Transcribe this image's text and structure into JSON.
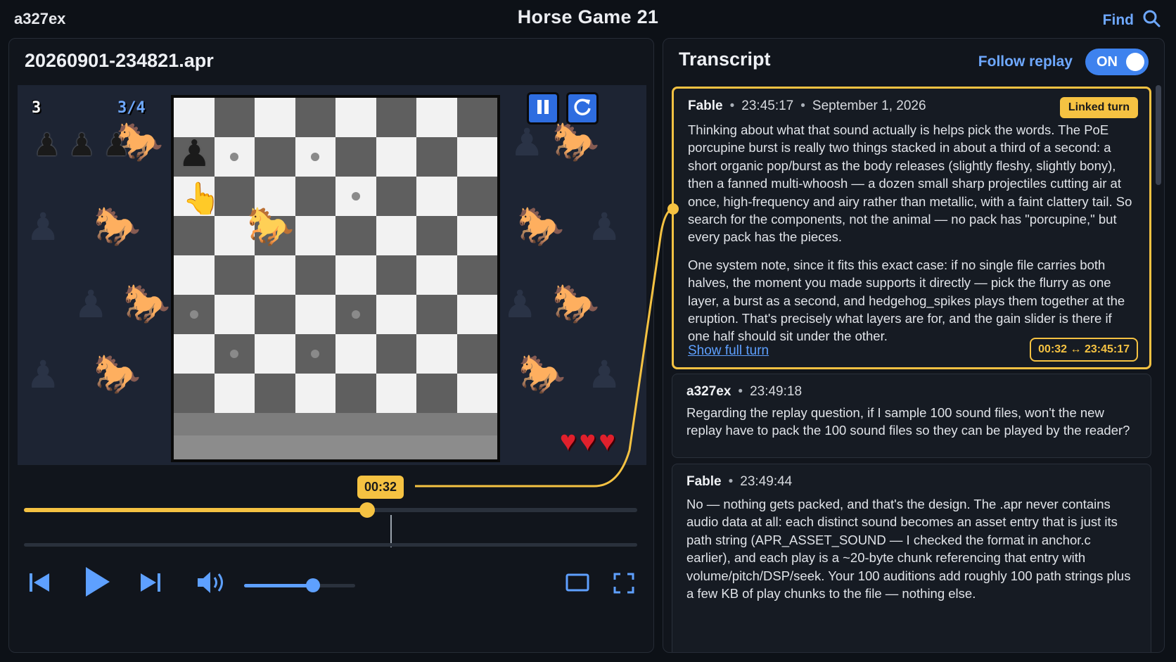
{
  "topbar": {
    "user": "a327ex",
    "title": "Horse Game 21",
    "find_label": "Find"
  },
  "player": {
    "filename": "20260901-234821.apr",
    "hud": {
      "level": "3",
      "pawns_count": "3/4",
      "pawns_remaining": 3,
      "hearts": 3
    },
    "game_controls": {
      "pause_icon": "pause-icon",
      "restart_icon": "restart-icon"
    },
    "timeline": {
      "current_time": "00:32",
      "progress": 0.56
    },
    "volume": {
      "level": 0.62
    },
    "controls": [
      "skip-back-icon",
      "play-icon",
      "skip-forward-icon",
      "volume-icon",
      "theater-mode-icon",
      "fullscreen-icon"
    ]
  },
  "transcript": {
    "title": "Transcript",
    "follow_label": "Follow replay",
    "toggle_label": "ON",
    "scroll_position": 0.0,
    "entries": [
      {
        "author": "Fable",
        "time": "23:45:17",
        "date": "September 1, 2026",
        "badge": "Linked turn",
        "paragraphs": [
          "Thinking about what that sound actually is helps pick the words. The PoE porcupine burst is really two things stacked in about a third of a second: a short organic pop/burst as the body releases (slightly fleshy, slightly bony), then a fanned multi-whoosh — a dozen small sharp projectiles cutting air at once, high-frequency and airy rather than metallic, with a faint clattery tail. So search for the components, not the animal — no pack has \"porcupine,\" but every pack has the pieces.",
          "One system note, since it fits this exact case: if no single file carries both halves, the moment you made supports it directly — pick the flurry as one layer, a burst as a second, and hedgehog_spikes plays them together at the eruption. That's precisely what layers are for, and the gain slider is there if one half should sit under the other."
        ],
        "show_full": "Show full turn",
        "time_map": "00:32 ↔ 23:45:17"
      },
      {
        "author": "a327ex",
        "time": "23:49:18",
        "paragraphs": [
          "Regarding the replay question, if I sample 100 sound files, won't the new replay have to pack the 100 sound files so they can be played by the reader?"
        ]
      },
      {
        "author": "Fable",
        "time": "23:49:44",
        "paragraphs": [
          "No — nothing gets packed, and that's the design. The .apr never contains audio data at all: each distinct sound becomes an asset entry that is just its path string (APR_ASSET_SOUND — I checked the format in anchor.c earlier), and each play is a ~20-byte chunk referencing that entry with volume/pitch/DSP/seek. Your 100 auditions add roughly 100 path strings plus a few KB of play chunks to the file — nothing else."
        ]
      }
    ]
  },
  "colors": {
    "accent_blue": "#5ea0ff",
    "accent_yellow": "#f5c242",
    "heart_red": "#e0202c"
  }
}
